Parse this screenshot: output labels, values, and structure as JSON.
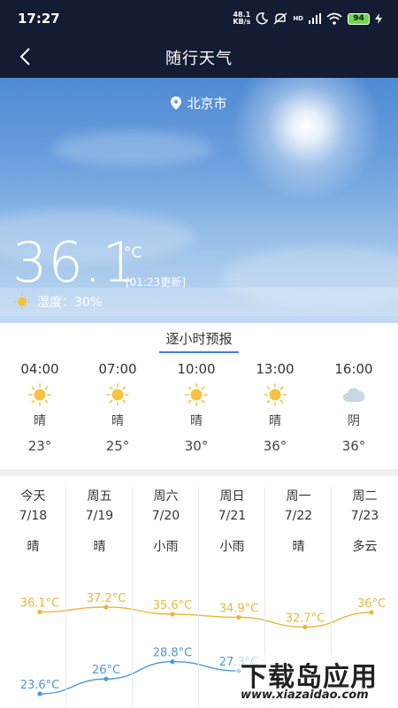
{
  "status_bar": {
    "time": "17:27",
    "net_speed_value": "48.1",
    "net_speed_unit": "KB/s",
    "signal_label": "HD",
    "battery": "94"
  },
  "header": {
    "title": "随行天气"
  },
  "current": {
    "location": "北京市",
    "temperature": "36.1",
    "unit": "°C",
    "updated": "[01:23更新]",
    "humidity": "湿度：30%"
  },
  "hourly": {
    "tab_label": "逐小时预报",
    "items": [
      {
        "time": "04:00",
        "icon": "sun-icon",
        "condition": "晴",
        "temp": "23°"
      },
      {
        "time": "07:00",
        "icon": "sun-icon",
        "condition": "晴",
        "temp": "25°"
      },
      {
        "time": "10:00",
        "icon": "sun-icon",
        "condition": "晴",
        "temp": "30°"
      },
      {
        "time": "13:00",
        "icon": "sun-icon",
        "condition": "晴",
        "temp": "36°"
      },
      {
        "time": "16:00",
        "icon": "cloud-icon",
        "condition": "阴",
        "temp": "36°"
      }
    ]
  },
  "daily": {
    "items": [
      {
        "day": "今天",
        "date": "7/18",
        "condition": "晴",
        "high": "36.1°C",
        "low": "23.6°C"
      },
      {
        "day": "周五",
        "date": "7/19",
        "condition": "晴",
        "high": "37.2°C",
        "low": "26°C"
      },
      {
        "day": "周六",
        "date": "7/20",
        "condition": "小雨",
        "high": "35.6°C",
        "low": "28.8°C"
      },
      {
        "day": "周日",
        "date": "7/21",
        "condition": "小雨",
        "high": "34.9°C",
        "low": "27.3°C"
      },
      {
        "day": "周一",
        "date": "7/22",
        "condition": "晴",
        "high": "32.7°C",
        "low": ""
      },
      {
        "day": "周二",
        "date": "7/23",
        "condition": "多云",
        "high": "36°C",
        "low": ""
      }
    ]
  },
  "chart_data": {
    "type": "line",
    "categories": [
      "今天",
      "周五",
      "周六",
      "周日",
      "周一",
      "周二"
    ],
    "series": [
      {
        "values": [
          36.1,
          37.2,
          35.6,
          34.9,
          32.7,
          36
        ],
        "color": "#e8b83a"
      },
      {
        "values": [
          23.6,
          26,
          28.8,
          27.3
        ],
        "color": "#4a9ad4"
      }
    ],
    "grid": false
  },
  "watermark": {
    "title": "下载岛应用",
    "url": "www.xiazaidao.com"
  }
}
